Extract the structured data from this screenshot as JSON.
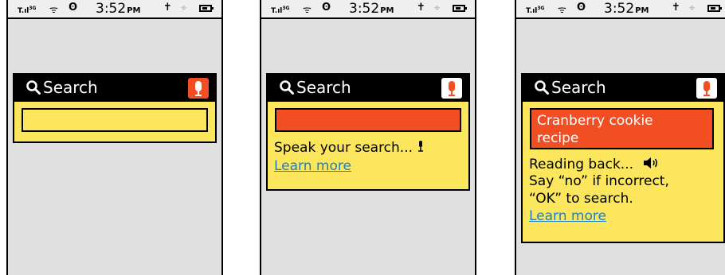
{
  "status": {
    "time": "3:52",
    "ampm": "PM",
    "network": "3G"
  },
  "colors": {
    "accent": "#f24e23",
    "panel": "#fbe65e",
    "link": "#1e7fc0",
    "screen": "#e0e0e0"
  },
  "panel1": {
    "search_label": "Search"
  },
  "panel2": {
    "search_label": "Search",
    "prompt": "Speak your search...",
    "learn_more": "Learn more"
  },
  "panel3": {
    "search_label": "Search",
    "query_line1": "Cranberry cookie",
    "query_line2": "recipe",
    "reading": "Reading back...",
    "say_no": "Say “no” if incorrect,",
    "ok": "“OK” to search.",
    "learn_more": "Learn more"
  },
  "icons": [
    "signal-icon",
    "wifi-icon",
    "bluetooth-icon",
    "activity-icon",
    "gps-icon",
    "battery-icon",
    "search-icon",
    "microphone-icon",
    "speaker-icon"
  ]
}
